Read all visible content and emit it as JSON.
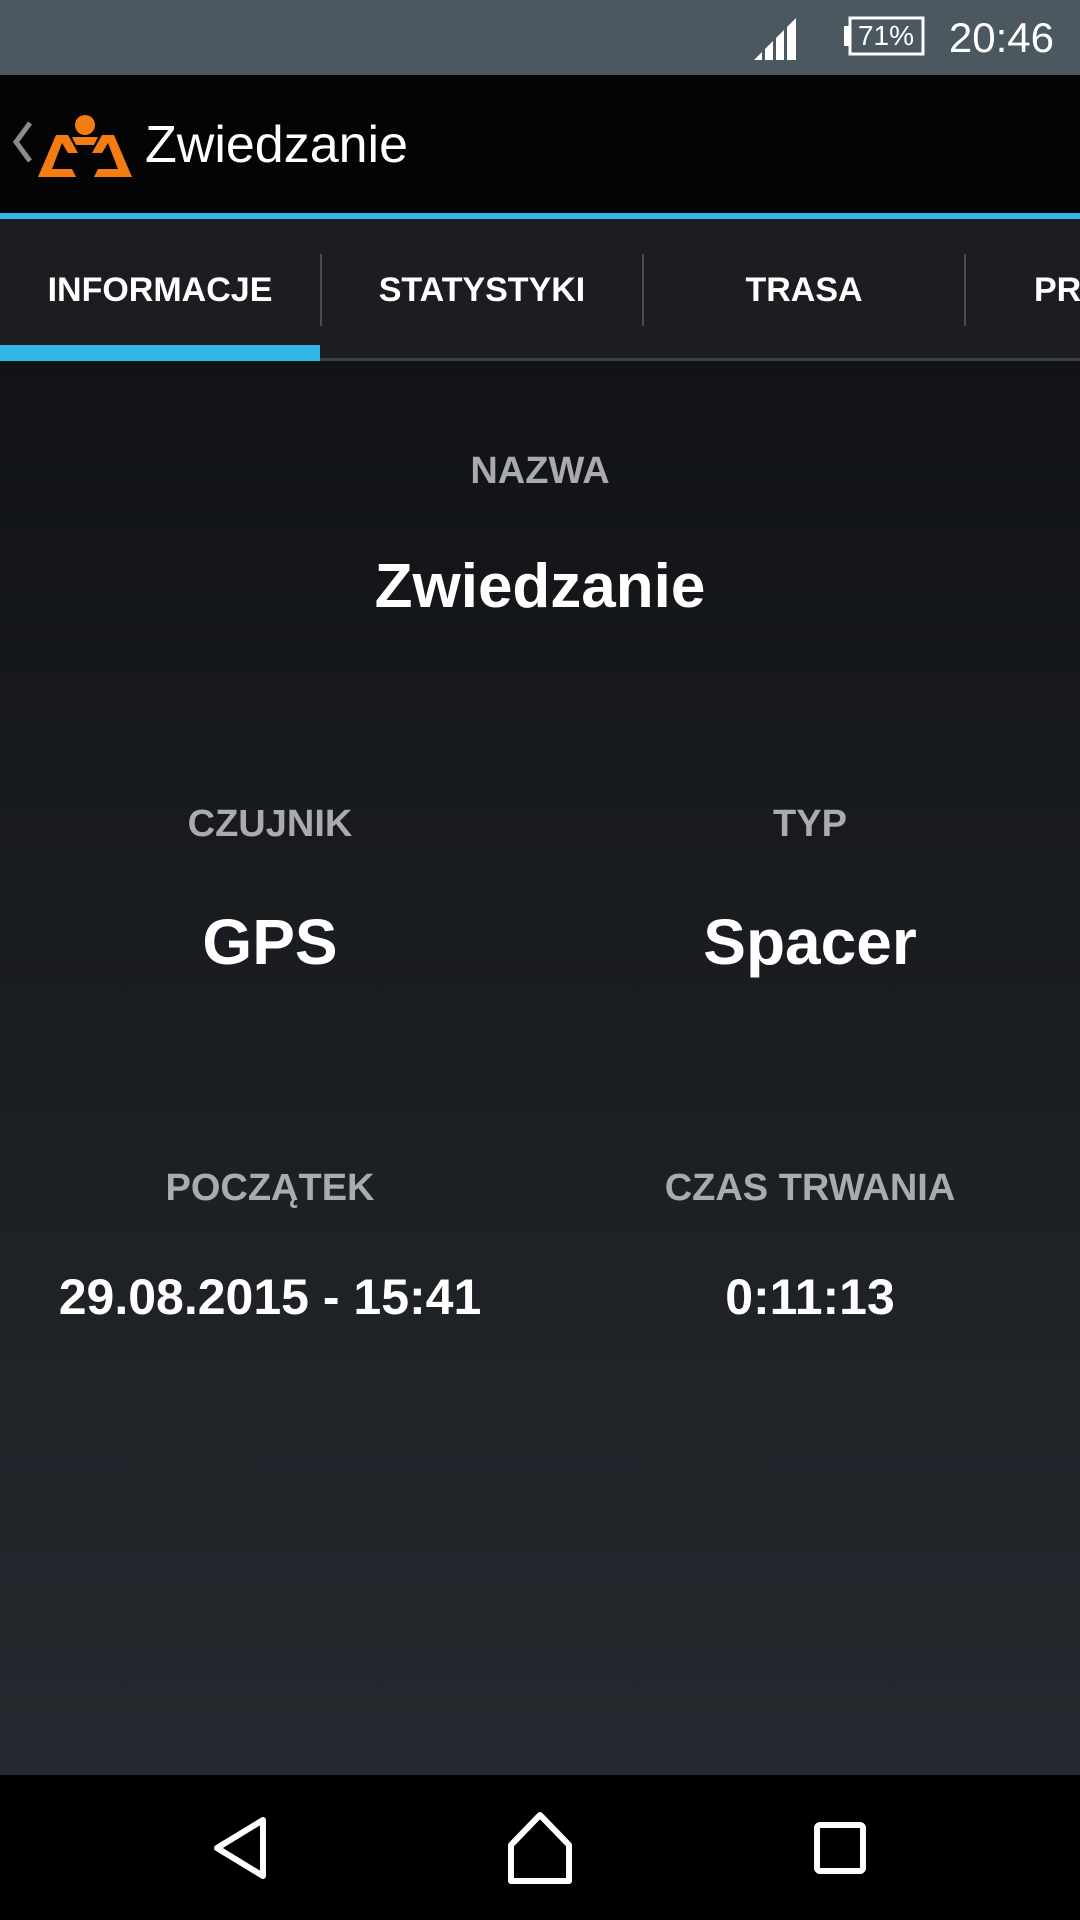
{
  "status_bar": {
    "battery": "71%",
    "time": "20:46",
    "icons": [
      "signal-icon",
      "battery-icon"
    ]
  },
  "action_bar": {
    "title": "Zwiedzanie",
    "icons": [
      "up-caret-icon",
      "app-logo-icon"
    ],
    "colors": {
      "logo": "#f57c13",
      "accent": "#33b5e5"
    }
  },
  "tabs": [
    {
      "label": "INFORMACJE",
      "selected": true
    },
    {
      "label": "STATYSTYKI",
      "selected": false
    },
    {
      "label": "TRASA",
      "selected": false
    },
    {
      "label": "PR",
      "selected": false
    }
  ],
  "info": {
    "name_label": "NAZWA",
    "name_value": "Zwiedzanie",
    "sensor_label": "CZUJNIK",
    "sensor_value": "GPS",
    "type_label": "TYP",
    "type_value": "Spacer",
    "start_label": "POCZĄTEK",
    "start_value": "29.08.2015 - 15:41",
    "duration_label": "CZAS TRWANIA",
    "duration_value": "0:11:13"
  },
  "nav_bar": {
    "icons": [
      "back-icon",
      "home-icon",
      "recents-icon"
    ]
  }
}
